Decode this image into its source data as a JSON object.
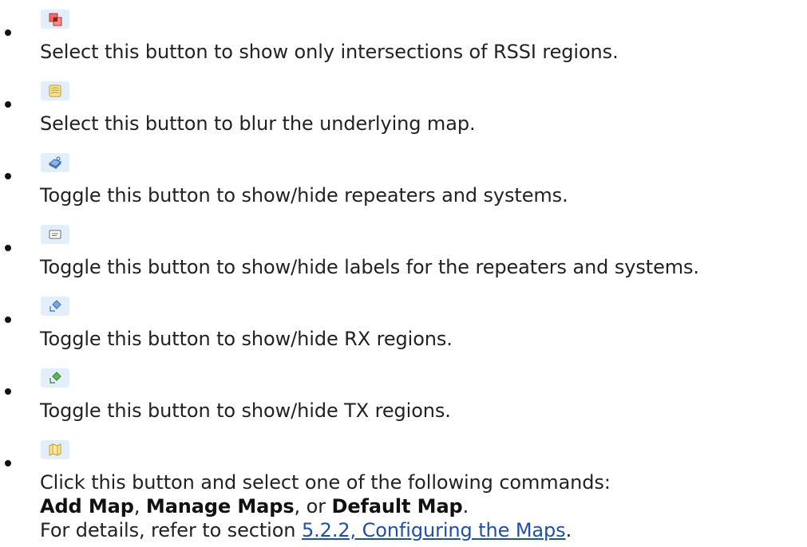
{
  "items": [
    {
      "icon": "rssi-intersection-icon",
      "text": "Select this button to show only intersections of RSSI regions."
    },
    {
      "icon": "blur-map-icon",
      "text": "Select this button to blur the underlying map."
    },
    {
      "icon": "repeaters-systems-icon",
      "text": "Toggle this button to show/hide repeaters and systems."
    },
    {
      "icon": "labels-icon",
      "text": "Toggle this button to show/hide labels for the repeaters and systems."
    },
    {
      "icon": "rx-regions-icon",
      "text": "Toggle this button to show/hide RX regions."
    },
    {
      "icon": "tx-regions-icon",
      "text": "Toggle this button to show/hide TX regions."
    },
    {
      "icon": "maps-menu-icon",
      "line1": "Click this button and select one of the following commands:",
      "cmd1": "Add Map",
      "sep1": ", ",
      "cmd2": "Manage Maps",
      "sep2": ", or ",
      "cmd3": "Default Map",
      "end2": ".",
      "line3_prefix": "For details, refer to section ",
      "link_text": "5.2.2, Configuring the Maps",
      "line3_suffix": "."
    }
  ]
}
